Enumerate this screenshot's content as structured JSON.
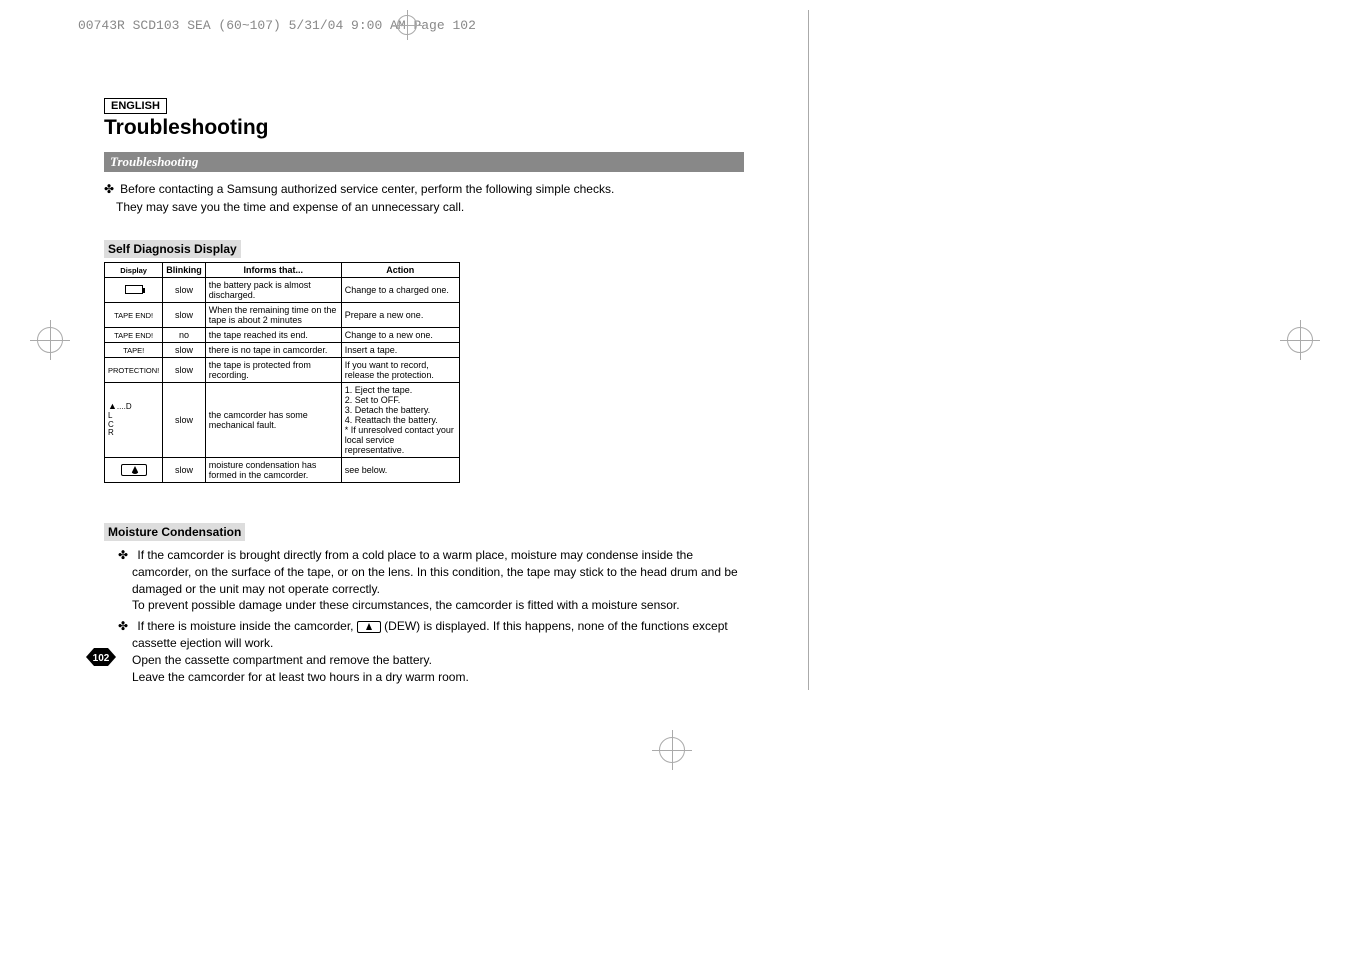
{
  "header_line": "00743R SCD103 SEA (60~107)  5/31/04 9:00 AM  Page 102",
  "language_label": "ENGLISH",
  "page_title": "Troubleshooting",
  "section_band": "Troubleshooting",
  "intro": {
    "line1": "Before contacting a Samsung authorized service center, perform the following simple checks.",
    "line2": "They may save you the time and expense of an unnecessary call."
  },
  "diagnosis_heading": "Self Diagnosis Display",
  "table": {
    "headers": {
      "display": "Display",
      "blinking": "Blinking",
      "informs": "Informs that...",
      "action": "Action"
    },
    "rows": [
      {
        "display_type": "battery",
        "display": "",
        "blinking": "slow",
        "informs": "the battery pack is almost discharged.",
        "action": "Change to a charged one."
      },
      {
        "display_type": "text",
        "display": "TAPE END!",
        "blinking": "slow",
        "informs": "When the remaining time on the tape is about 2 minutes",
        "action": "Prepare a new one."
      },
      {
        "display_type": "text",
        "display": "TAPE END!",
        "blinking": "no",
        "informs": "the tape reached its end.",
        "action": "Change to a new one."
      },
      {
        "display_type": "text",
        "display": "TAPE!",
        "blinking": "slow",
        "informs": "there is no tape in camcorder.",
        "action": "Insert a tape."
      },
      {
        "display_type": "text",
        "display": "PROTECTION!",
        "blinking": "slow",
        "informs": "the tape is protected from recording.",
        "action": "If you want to record, release the protection."
      },
      {
        "display_type": "eject",
        "display": "....D\nL\nC\nR",
        "blinking": "slow",
        "informs": "the camcorder has some mechanical fault.",
        "action": "1. Eject the tape.\n2. Set to OFF.\n3. Detach the battery.\n4. Reattach the battery.\n* If unresolved contact your\n  local service representative."
      },
      {
        "display_type": "dew",
        "display": "",
        "blinking": "slow",
        "informs": "moisture condensation has formed in the camcorder.",
        "action": "see below."
      }
    ]
  },
  "moisture_heading": "Moisture Condensation",
  "moisture": {
    "p1": "If the camcorder is brought directly from a cold place to a warm place, moisture may condense inside the camcorder, on the surface of the tape, or on the lens. In this condition, the tape may stick to the head drum and be damaged or the unit may not operate correctly.",
    "p1b": "To prevent possible damage under these circumstances, the camcorder is fitted with a moisture sensor.",
    "p2a": "If there is moisture inside the camcorder, ",
    "p2b": " (DEW) is displayed. If this happens, none of the functions except cassette ejection will work.",
    "p2c": "Open the cassette compartment and remove the battery.",
    "p2d": "Leave the camcorder for at least two hours in a dry warm room."
  },
  "page_number": "102"
}
